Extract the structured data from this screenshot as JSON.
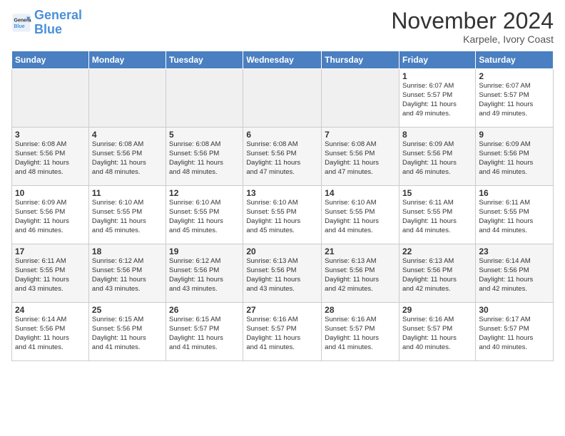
{
  "header": {
    "logo_line1": "General",
    "logo_line2": "Blue",
    "month": "November 2024",
    "location": "Karpele, Ivory Coast"
  },
  "weekdays": [
    "Sunday",
    "Monday",
    "Tuesday",
    "Wednesday",
    "Thursday",
    "Friday",
    "Saturday"
  ],
  "weeks": [
    [
      {
        "day": "",
        "info": ""
      },
      {
        "day": "",
        "info": ""
      },
      {
        "day": "",
        "info": ""
      },
      {
        "day": "",
        "info": ""
      },
      {
        "day": "",
        "info": ""
      },
      {
        "day": "1",
        "info": "Sunrise: 6:07 AM\nSunset: 5:57 PM\nDaylight: 11 hours\nand 49 minutes."
      },
      {
        "day": "2",
        "info": "Sunrise: 6:07 AM\nSunset: 5:57 PM\nDaylight: 11 hours\nand 49 minutes."
      }
    ],
    [
      {
        "day": "3",
        "info": "Sunrise: 6:08 AM\nSunset: 5:56 PM\nDaylight: 11 hours\nand 48 minutes."
      },
      {
        "day": "4",
        "info": "Sunrise: 6:08 AM\nSunset: 5:56 PM\nDaylight: 11 hours\nand 48 minutes."
      },
      {
        "day": "5",
        "info": "Sunrise: 6:08 AM\nSunset: 5:56 PM\nDaylight: 11 hours\nand 48 minutes."
      },
      {
        "day": "6",
        "info": "Sunrise: 6:08 AM\nSunset: 5:56 PM\nDaylight: 11 hours\nand 47 minutes."
      },
      {
        "day": "7",
        "info": "Sunrise: 6:08 AM\nSunset: 5:56 PM\nDaylight: 11 hours\nand 47 minutes."
      },
      {
        "day": "8",
        "info": "Sunrise: 6:09 AM\nSunset: 5:56 PM\nDaylight: 11 hours\nand 46 minutes."
      },
      {
        "day": "9",
        "info": "Sunrise: 6:09 AM\nSunset: 5:56 PM\nDaylight: 11 hours\nand 46 minutes."
      }
    ],
    [
      {
        "day": "10",
        "info": "Sunrise: 6:09 AM\nSunset: 5:56 PM\nDaylight: 11 hours\nand 46 minutes."
      },
      {
        "day": "11",
        "info": "Sunrise: 6:10 AM\nSunset: 5:55 PM\nDaylight: 11 hours\nand 45 minutes."
      },
      {
        "day": "12",
        "info": "Sunrise: 6:10 AM\nSunset: 5:55 PM\nDaylight: 11 hours\nand 45 minutes."
      },
      {
        "day": "13",
        "info": "Sunrise: 6:10 AM\nSunset: 5:55 PM\nDaylight: 11 hours\nand 45 minutes."
      },
      {
        "day": "14",
        "info": "Sunrise: 6:10 AM\nSunset: 5:55 PM\nDaylight: 11 hours\nand 44 minutes."
      },
      {
        "day": "15",
        "info": "Sunrise: 6:11 AM\nSunset: 5:55 PM\nDaylight: 11 hours\nand 44 minutes."
      },
      {
        "day": "16",
        "info": "Sunrise: 6:11 AM\nSunset: 5:55 PM\nDaylight: 11 hours\nand 44 minutes."
      }
    ],
    [
      {
        "day": "17",
        "info": "Sunrise: 6:11 AM\nSunset: 5:55 PM\nDaylight: 11 hours\nand 43 minutes."
      },
      {
        "day": "18",
        "info": "Sunrise: 6:12 AM\nSunset: 5:56 PM\nDaylight: 11 hours\nand 43 minutes."
      },
      {
        "day": "19",
        "info": "Sunrise: 6:12 AM\nSunset: 5:56 PM\nDaylight: 11 hours\nand 43 minutes."
      },
      {
        "day": "20",
        "info": "Sunrise: 6:13 AM\nSunset: 5:56 PM\nDaylight: 11 hours\nand 43 minutes."
      },
      {
        "day": "21",
        "info": "Sunrise: 6:13 AM\nSunset: 5:56 PM\nDaylight: 11 hours\nand 42 minutes."
      },
      {
        "day": "22",
        "info": "Sunrise: 6:13 AM\nSunset: 5:56 PM\nDaylight: 11 hours\nand 42 minutes."
      },
      {
        "day": "23",
        "info": "Sunrise: 6:14 AM\nSunset: 5:56 PM\nDaylight: 11 hours\nand 42 minutes."
      }
    ],
    [
      {
        "day": "24",
        "info": "Sunrise: 6:14 AM\nSunset: 5:56 PM\nDaylight: 11 hours\nand 41 minutes."
      },
      {
        "day": "25",
        "info": "Sunrise: 6:15 AM\nSunset: 5:56 PM\nDaylight: 11 hours\nand 41 minutes."
      },
      {
        "day": "26",
        "info": "Sunrise: 6:15 AM\nSunset: 5:57 PM\nDaylight: 11 hours\nand 41 minutes."
      },
      {
        "day": "27",
        "info": "Sunrise: 6:16 AM\nSunset: 5:57 PM\nDaylight: 11 hours\nand 41 minutes."
      },
      {
        "day": "28",
        "info": "Sunrise: 6:16 AM\nSunset: 5:57 PM\nDaylight: 11 hours\nand 41 minutes."
      },
      {
        "day": "29",
        "info": "Sunrise: 6:16 AM\nSunset: 5:57 PM\nDaylight: 11 hours\nand 40 minutes."
      },
      {
        "day": "30",
        "info": "Sunrise: 6:17 AM\nSunset: 5:57 PM\nDaylight: 11 hours\nand 40 minutes."
      }
    ]
  ]
}
